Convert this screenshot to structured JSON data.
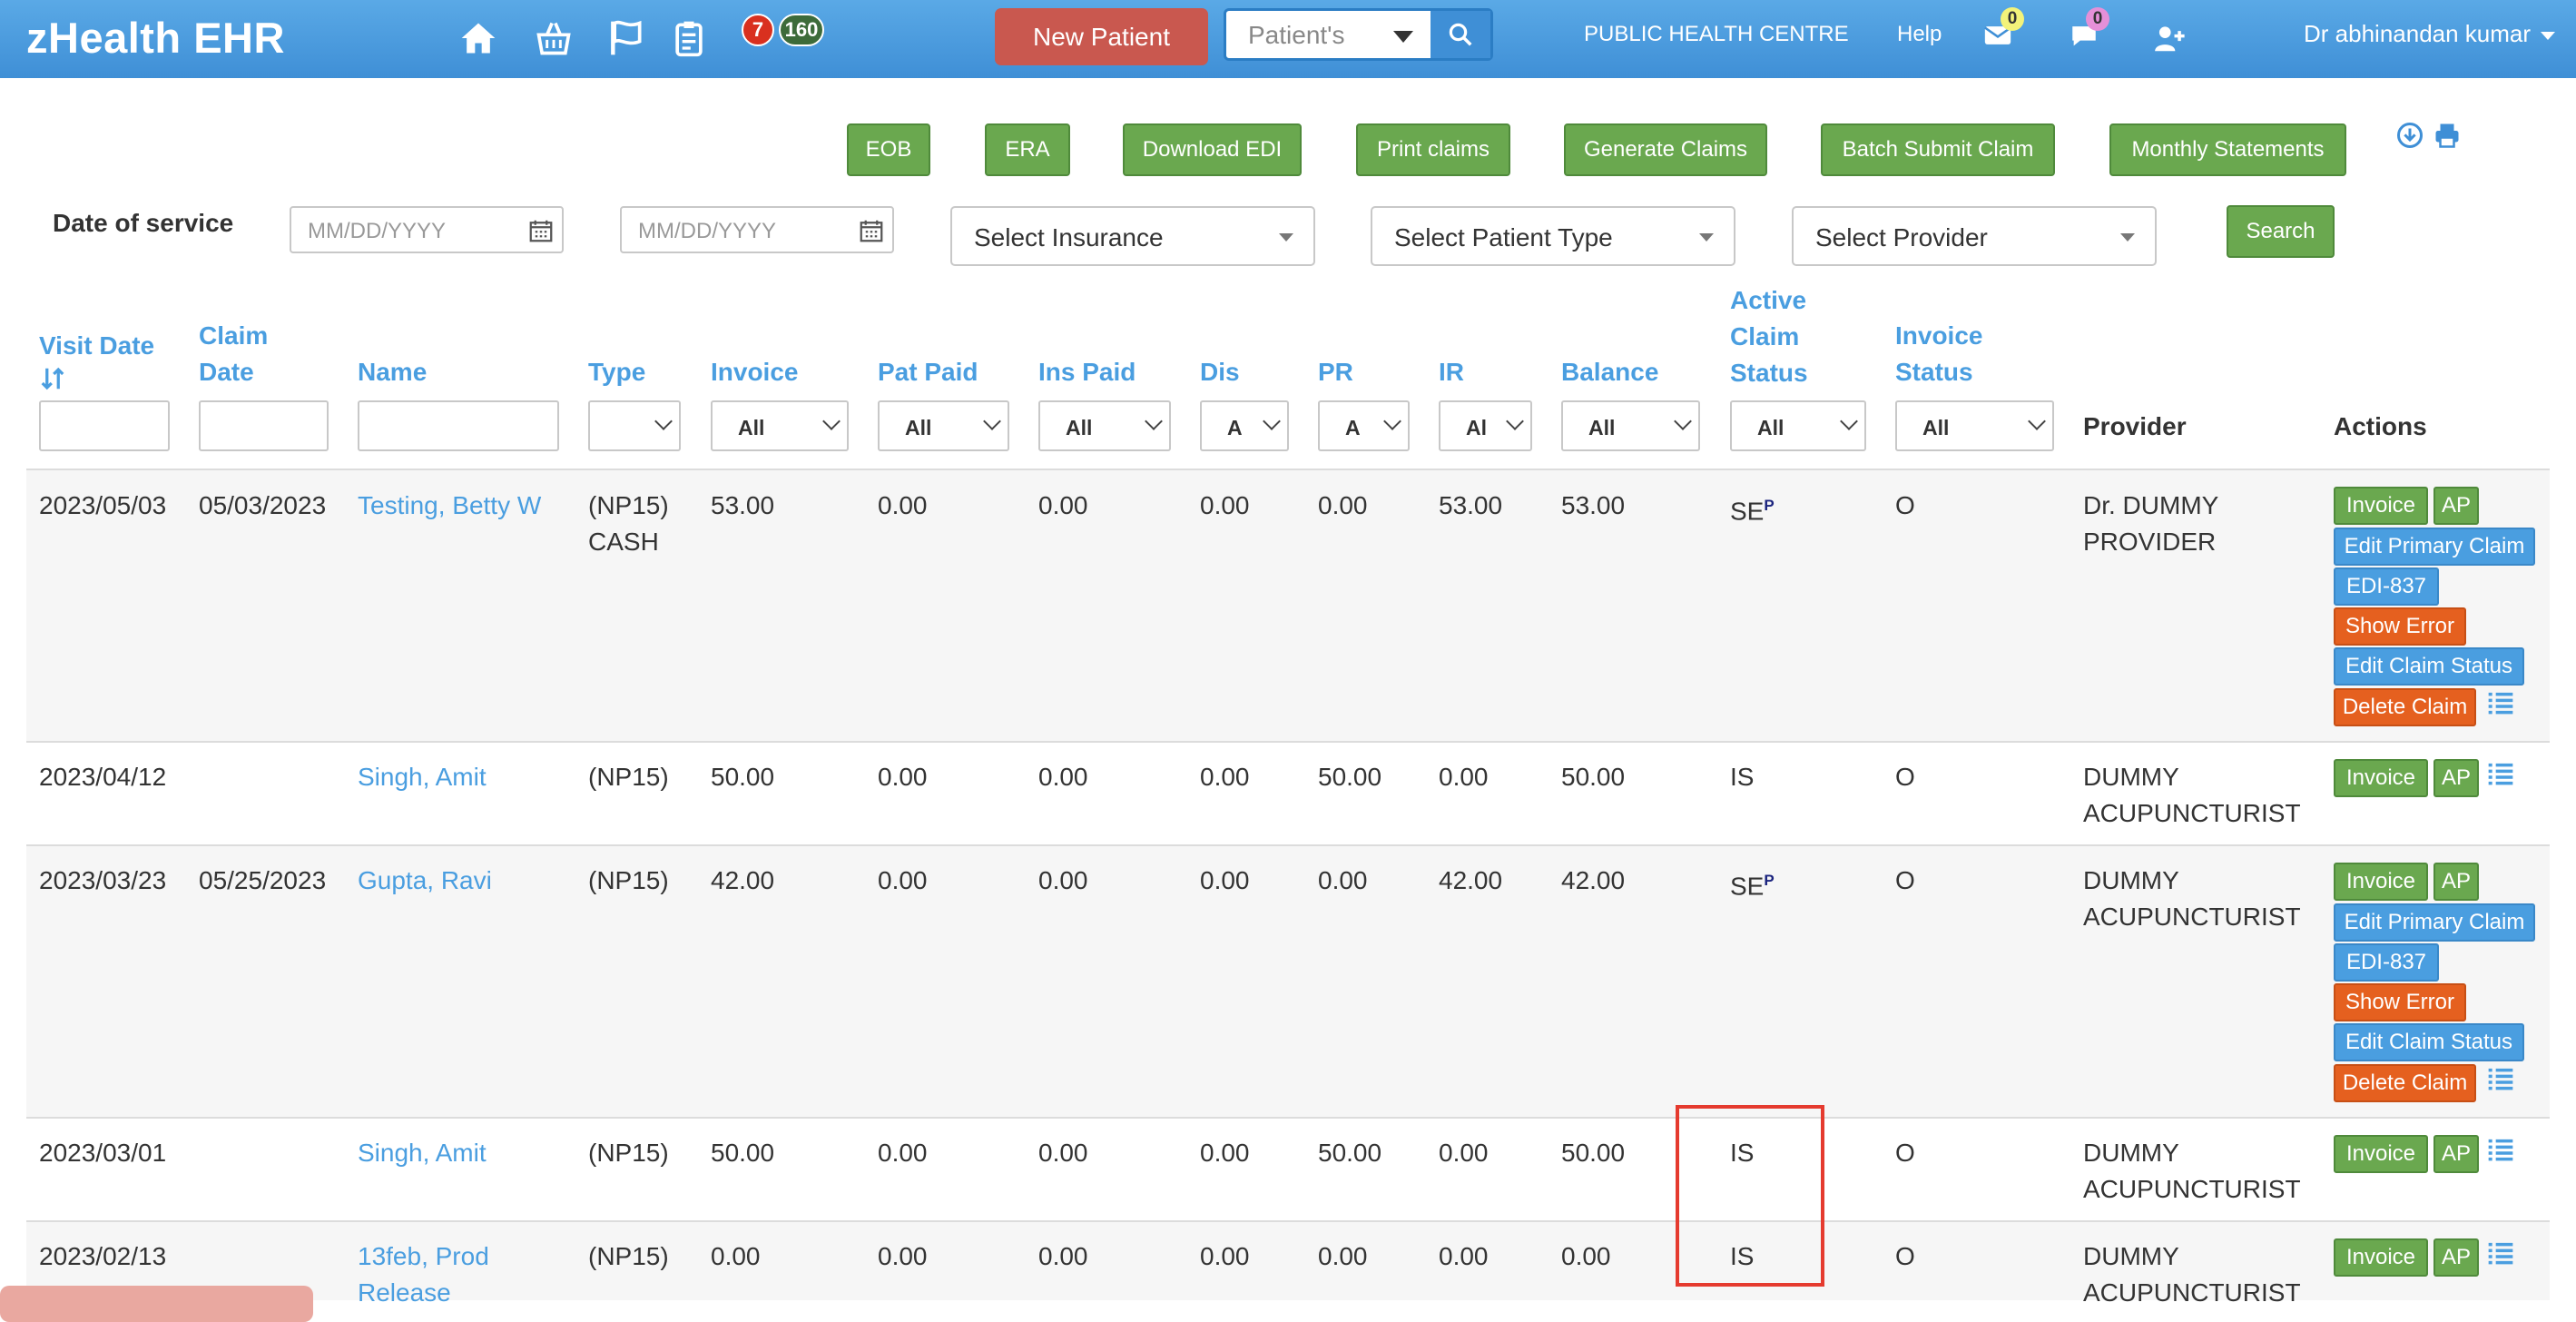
{
  "app": {
    "brand": "zHealth EHR",
    "badge_red": "7",
    "badge_green": "160",
    "new_patient_label": "New Patient",
    "patient_search_label": "Patient's",
    "clinic": "PUBLIC HEALTH CENTRE",
    "help": "Help",
    "mail_count": "0",
    "chat_count": "0",
    "user": "Dr abhinandan kumar"
  },
  "toolbar": [
    "EOB",
    "ERA",
    "Download EDI",
    "Print claims",
    "Generate Claims",
    "Batch Submit Claim",
    "Monthly Statements"
  ],
  "filters": {
    "dos_label": "Date of service",
    "date_placeholder": "MM/DD/YYYY",
    "insurance": "Select Insurance",
    "patient_type": "Select Patient Type",
    "provider": "Select Provider",
    "search": "Search"
  },
  "table": {
    "headers": {
      "visit_date": "Visit Date",
      "claim_date_1": "Claim",
      "claim_date_2": "Date",
      "name": "Name",
      "type": "Type",
      "invoice": "Invoice",
      "pat_paid": "Pat Paid",
      "ins_paid": "Ins Paid",
      "dis": "Dis",
      "pr": "PR",
      "ir": "IR",
      "balance": "Balance",
      "acs_1": "Active",
      "acs_2": "Claim",
      "acs_3": "Status",
      "inv_status_1": "Invoice",
      "inv_status_2": "Status",
      "provider": "Provider",
      "actions": "Actions"
    },
    "filter_all": "All",
    "filter_all_a": "A",
    "filter_all_al": "Al",
    "rows": [
      {
        "visit": "2023/05/03",
        "claim": "05/03/2023",
        "name1": "Testing, Betty W",
        "name2": "",
        "type1": "(NP15)",
        "type2": "CASH",
        "invoice": "53.00",
        "pat": "0.00",
        "ins": "0.00",
        "dis": "0.00",
        "pr": "0.00",
        "ir": "53.00",
        "bal": "53.00",
        "acs": "SE",
        "acs_sup": "P",
        "inv": "O",
        "prov1": "Dr. DUMMY",
        "prov2": "PROVIDER"
      },
      {
        "visit": "2023/04/12",
        "claim": "",
        "name1": "Singh, Amit",
        "name2": "",
        "type1": "(NP15)",
        "type2": "",
        "invoice": "50.00",
        "pat": "0.00",
        "ins": "0.00",
        "dis": "0.00",
        "pr": "50.00",
        "ir": "0.00",
        "bal": "50.00",
        "acs": "IS",
        "acs_sup": "",
        "inv": "O",
        "prov1": "DUMMY",
        "prov2": "ACUPUNCTURIST"
      },
      {
        "visit": "2023/03/23",
        "claim": "05/25/2023",
        "name1": "Gupta, Ravi",
        "name2": "",
        "type1": "(NP15)",
        "type2": "",
        "invoice": "42.00",
        "pat": "0.00",
        "ins": "0.00",
        "dis": "0.00",
        "pr": "0.00",
        "ir": "42.00",
        "bal": "42.00",
        "acs": "SE",
        "acs_sup": "P",
        "inv": "O",
        "prov1": "DUMMY",
        "prov2": "ACUPUNCTURIST"
      },
      {
        "visit": "2023/03/01",
        "claim": "",
        "name1": "Singh, Amit",
        "name2": "",
        "type1": "(NP15)",
        "type2": "",
        "invoice": "50.00",
        "pat": "0.00",
        "ins": "0.00",
        "dis": "0.00",
        "pr": "50.00",
        "ir": "0.00",
        "bal": "50.00",
        "acs": "IS",
        "acs_sup": "",
        "inv": "O",
        "prov1": "DUMMY",
        "prov2": "ACUPUNCTURIST"
      },
      {
        "visit": "2023/02/13",
        "claim": "",
        "name1": "13feb, Prod",
        "name2": "Release",
        "type1": "(NP15)",
        "type2": "",
        "invoice": "0.00",
        "pat": "0.00",
        "ins": "0.00",
        "dis": "0.00",
        "pr": "0.00",
        "ir": "0.00",
        "bal": "0.00",
        "acs": "IS",
        "acs_sup": "",
        "inv": "O",
        "prov1": "DUMMY",
        "prov2": "ACUPUNCTURIST"
      }
    ],
    "actions": {
      "invoice": "Invoice",
      "ap": "AP",
      "edit_primary": "Edit Primary Claim",
      "edi": "EDI-837",
      "show_error": "Show Error",
      "edit_status": "Edit Claim Status",
      "delete": "Delete Claim"
    }
  },
  "colors": {
    "nav": "#4a9ee0",
    "green": "#6aa84f",
    "blue": "#4a9ee0",
    "orange": "#e5601f",
    "highlight": "#e53b2f"
  }
}
